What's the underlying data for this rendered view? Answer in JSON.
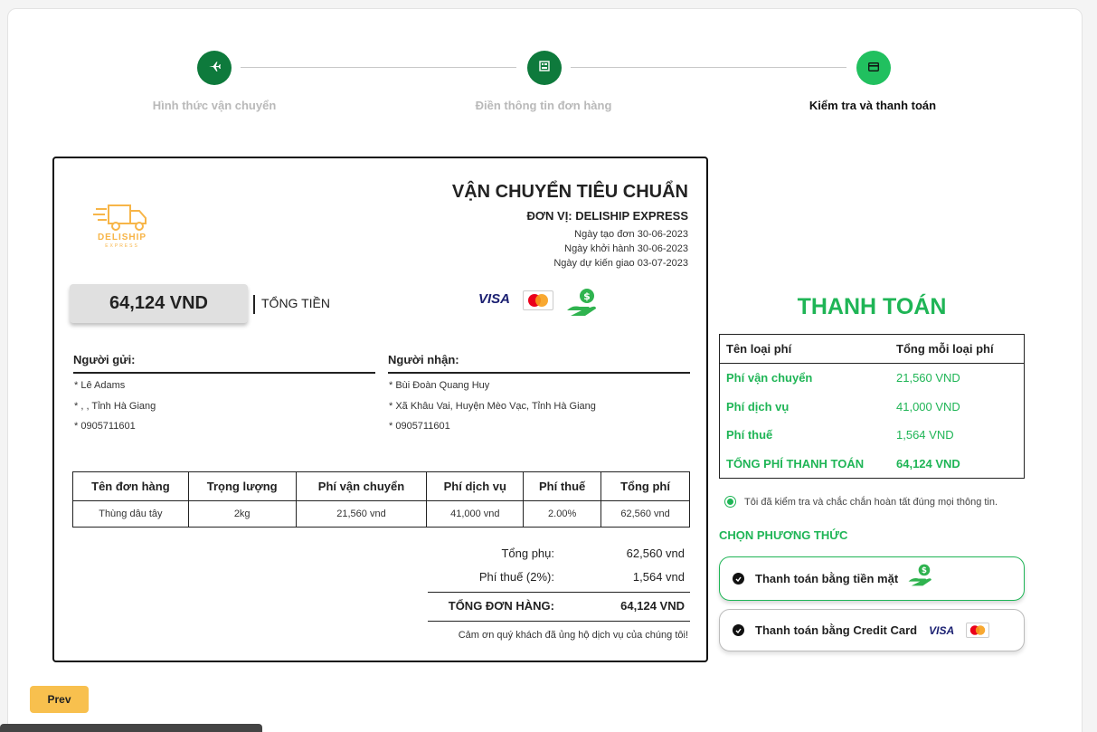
{
  "stepper": {
    "steps": [
      {
        "label": "Hình thức vận chuyển",
        "icon": "plane-icon"
      },
      {
        "label": "Điền thông tin đơn hàng",
        "icon": "form-icon"
      },
      {
        "label": "Kiểm tra và thanh toán",
        "icon": "card-icon"
      }
    ],
    "colors": {
      "done": "#0e7a3c",
      "active": "#21c05f",
      "pending_label": "#b9b9b9"
    }
  },
  "invoice": {
    "logo_text": "DELISHIP",
    "logo_sub": "EXPRESS",
    "title": "VẬN CHUYỂN TIÊU CHUẨN",
    "unit": "ĐƠN VỊ: DELISHIP EXPRESS",
    "dates": [
      "Ngày tạo đơn 30-06-2023",
      "Ngày khởi hành 30-06-2023",
      "Ngày dự kiến giao 03-07-2023"
    ],
    "total_amount": "64,124 VND",
    "total_label": "TỔNG TIỀN",
    "sender": {
      "heading": "Người gửi:",
      "lines": [
        "* Lê Adams",
        "* , , Tỉnh Hà Giang",
        "* 0905711601"
      ]
    },
    "receiver": {
      "heading": "Người nhận:",
      "lines": [
        "* Bùi Đoàn Quang Huy",
        "* Xã Khâu Vai, Huyện Mèo Vạc, Tỉnh Hà Giang",
        "* 0905711601"
      ]
    },
    "table": {
      "headers": [
        "Tên đơn hàng",
        "Trọng lượng",
        "Phí vận chuyển",
        "Phí dịch vụ",
        "Phí thuế",
        "Tổng phí"
      ],
      "row": [
        "Thùng dâu tây",
        "2kg",
        "21,560 vnd",
        "41,000 vnd",
        "2.00%",
        "62,560 vnd"
      ]
    },
    "summary": {
      "subtotal_label": "Tổng phụ:",
      "subtotal": "62,560 vnd",
      "tax_label": "Phí thuế (2%):",
      "tax": "1,564 vnd",
      "total_label": "TỔNG ĐƠN HÀNG:",
      "total": "64,124 VND"
    },
    "thanks": "Cảm ơn quý khách đã ủng hộ dịch vụ của chúng tôi!"
  },
  "payment": {
    "title": "THANH TOÁN",
    "fee_headers": [
      "Tên loại phí",
      "Tổng mỗi loại phí"
    ],
    "fees": [
      {
        "name": "Phí vận chuyển",
        "value": "21,560 VND"
      },
      {
        "name": "Phí dịch vụ",
        "value": "41,000 VND"
      },
      {
        "name": "Phí thuế",
        "value": "1,564 VND"
      },
      {
        "name": "TỔNG PHÍ THANH TOÁN",
        "value": "64,124 VND"
      }
    ],
    "confirm_text": "Tôi đã kiểm tra và chắc chắn hoàn tất đúng mọi thông tin.",
    "method_title": "CHỌN PHƯƠNG THỨC",
    "methods": [
      "Thanh toán bằng tiền mặt",
      "Thanh toán bằng Credit Card"
    ],
    "visa_text": "VISA",
    "mastercard_text": "MasterCard",
    "accent": "#1fb556"
  },
  "nav": {
    "prev_label": "Prev"
  }
}
